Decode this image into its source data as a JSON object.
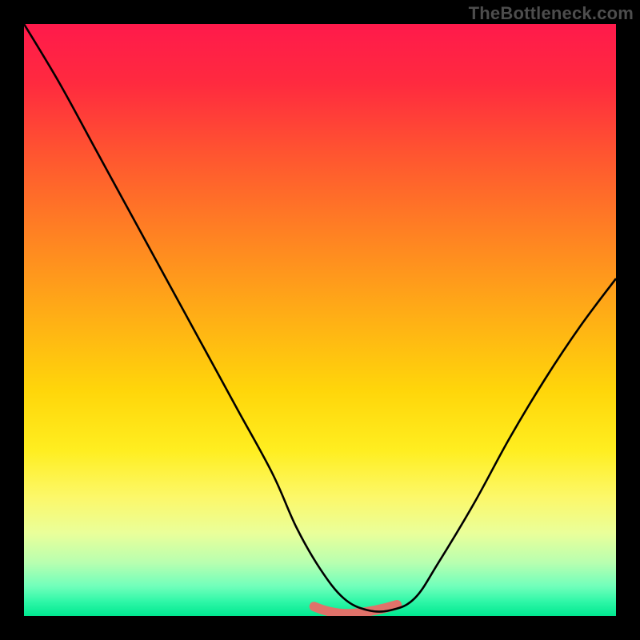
{
  "watermark": "TheBottleneck.com",
  "gradient_stops": [
    {
      "offset": 0.0,
      "color": "#ff1a4b"
    },
    {
      "offset": 0.1,
      "color": "#ff2a3f"
    },
    {
      "offset": 0.22,
      "color": "#ff5530"
    },
    {
      "offset": 0.35,
      "color": "#ff8023"
    },
    {
      "offset": 0.5,
      "color": "#ffb015"
    },
    {
      "offset": 0.62,
      "color": "#ffd60a"
    },
    {
      "offset": 0.72,
      "color": "#ffee20"
    },
    {
      "offset": 0.8,
      "color": "#fcf86a"
    },
    {
      "offset": 0.86,
      "color": "#eaff9a"
    },
    {
      "offset": 0.91,
      "color": "#b8ffb0"
    },
    {
      "offset": 0.95,
      "color": "#70ffbb"
    },
    {
      "offset": 0.975,
      "color": "#30f7a8"
    },
    {
      "offset": 1.0,
      "color": "#00e890"
    }
  ],
  "highlight_color": "#e0726a",
  "curve_color": "#000000",
  "chart_data": {
    "type": "line",
    "title": "",
    "xlabel": "",
    "ylabel": "",
    "xlim": [
      0,
      100
    ],
    "ylim": [
      0,
      100
    ],
    "series": [
      {
        "name": "bottleneck-curve",
        "x": [
          0,
          6,
          12,
          18,
          24,
          30,
          36,
          42,
          46,
          50,
          54,
          58,
          62,
          66,
          70,
          76,
          82,
          88,
          94,
          100
        ],
        "values": [
          100,
          90,
          79,
          68,
          57,
          46,
          35,
          24,
          15,
          8,
          3,
          1,
          1,
          3,
          9,
          19,
          30,
          40,
          49,
          57
        ]
      }
    ],
    "highlight_segment": {
      "x_start": 49,
      "x_end": 63,
      "y_floor": 1
    }
  }
}
